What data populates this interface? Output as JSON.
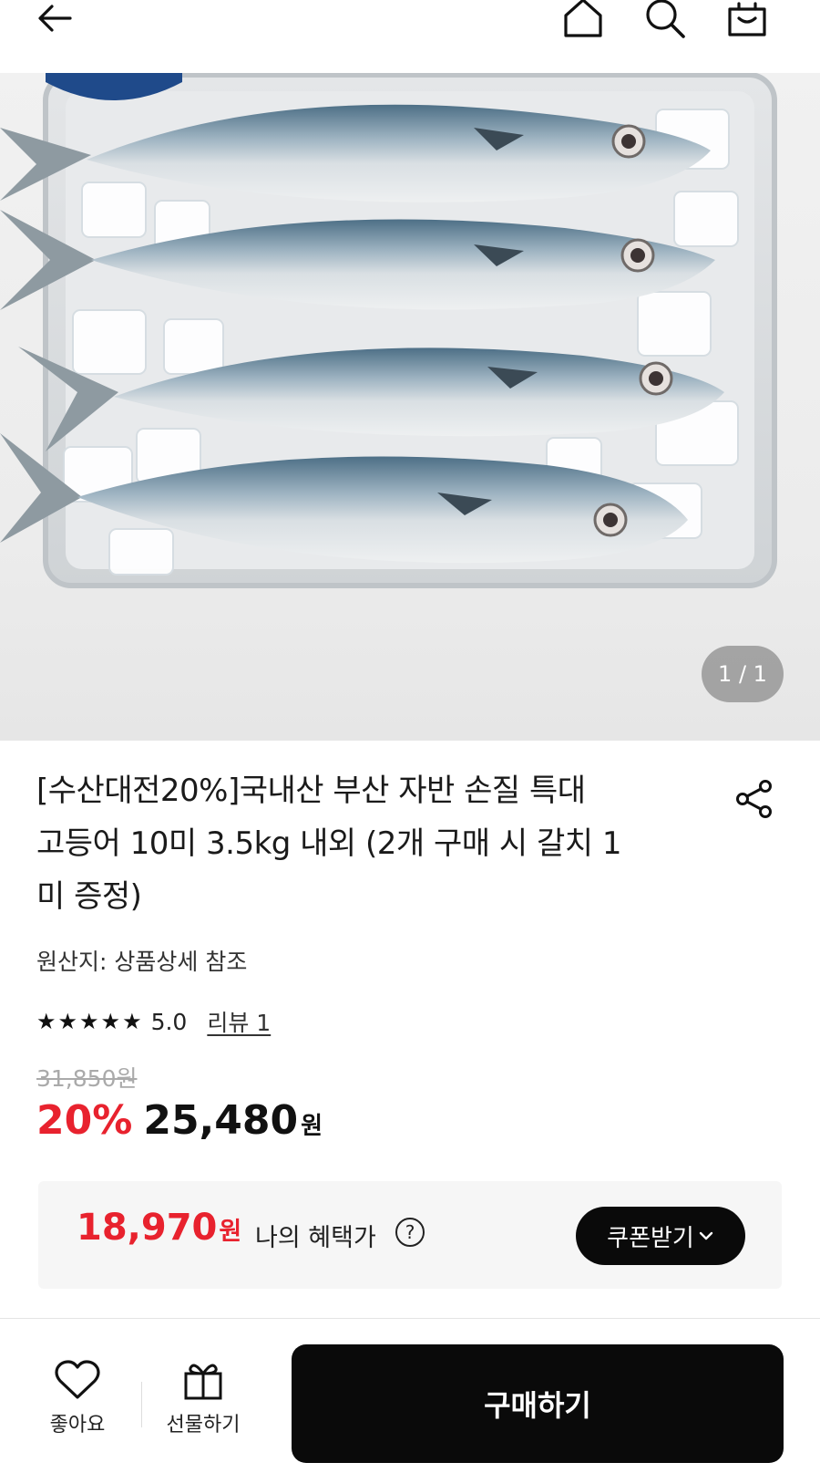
{
  "header": {
    "icons": [
      "back-arrow-icon",
      "home-icon",
      "search-icon",
      "shopping-bag-icon"
    ]
  },
  "hero": {
    "pager": "1 / 1"
  },
  "product": {
    "title_lines": [
      "[수산대전20%]국내산 부산 자반 손질 특대",
      "고등어 10미 3.5kg 내외 (2개 구매 시 갈치 1",
      "미 증정)"
    ],
    "origin": "원산지: 상품상세 참조",
    "rating": {
      "stars": 5,
      "value": "5.0",
      "review_link": "리뷰 1"
    },
    "original_price": "31,850원",
    "discount": "20%",
    "price": "25,480",
    "price_unit": "원"
  },
  "benefit": {
    "price": "18,970",
    "unit": "원",
    "label": "나의 혜택가",
    "help": "?",
    "coupon_button": "쿠폰받기",
    "coupon_chevron": "⌄"
  },
  "bottom_bar": {
    "like_label": "좋아요",
    "gift_label": "선물하기",
    "buy_label": "구매하기"
  },
  "colors": {
    "accent_red": "#e8222e",
    "button_black": "#0a0a0a"
  }
}
